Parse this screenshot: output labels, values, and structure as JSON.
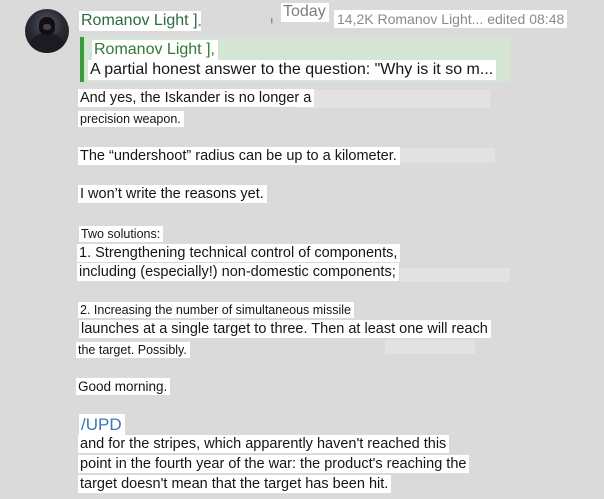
{
  "post": {
    "author": "Romanov Light ]",
    "date": "Today",
    "meta": "14,2K Romanov Light... edited 08:48"
  },
  "reply": {
    "author": "Romanov Light ],",
    "text": "A partial honest answer to the question: \"Why is it so m..."
  },
  "body": {
    "lines": [
      "And yes, the Iskander is no longer a",
      "precision weapon.",
      "The “undershoot” radius can be up to a kilometer.",
      "I won’t write the reasons yet.",
      "Two solutions:",
      "1. Strengthening technical control of components,",
      "including (especially!) non-domestic components;",
      "2. Increasing the number of simultaneous missile",
      "launches at a single target to three. Then at least one will reach",
      "the target. Possibly.",
      "Good morning.",
      "/UPD",
      "and for the stripes, which apparently haven't reached this",
      "point in the fourth year of the war: the product's reaching the",
      "target doesn't mean that the target has been hit."
    ]
  },
  "icons": {
    "avatar": "avatar-image",
    "pin": "pin-icon",
    "views": "views-icon"
  },
  "colors": {
    "accent_green": "#3c9a3c",
    "author_green": "#2c6b3f",
    "link_blue": "#3a79b5",
    "reply_bg": "#d4e6d3"
  }
}
